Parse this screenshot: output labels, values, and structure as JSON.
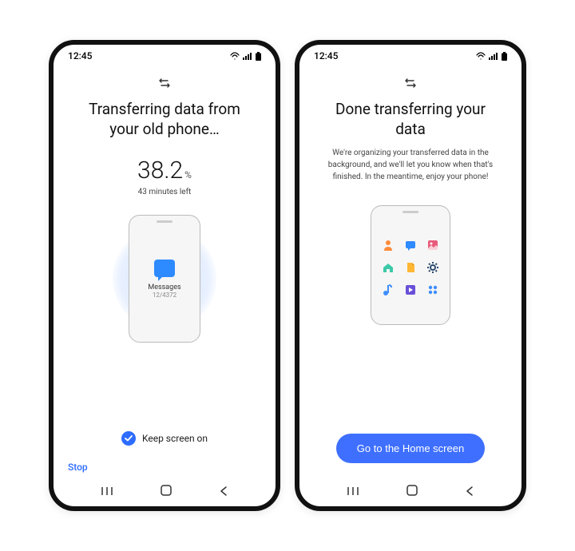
{
  "left": {
    "status": {
      "time": "12:45"
    },
    "title": "Transferring data from your old phone…",
    "percent_value": "38.2",
    "percent_symbol": "%",
    "time_left": "43 minutes left",
    "transfer_item": {
      "label": "Messages",
      "count": "12/4372",
      "icon": "message-icon"
    },
    "keep_screen_label": "Keep screen on",
    "stop_label": "Stop"
  },
  "right": {
    "status": {
      "time": "12:45"
    },
    "title": "Done transferring your data",
    "subtitle": "We're organizing your transferred data in the background, and we'll let you know when that's finished. In the meantime, enjoy your phone!",
    "grid_icons": [
      "contact-icon",
      "message-icon",
      "gallery-icon",
      "home-icon",
      "file-icon",
      "settings-icon",
      "music-icon",
      "video-icon",
      "apps-icon"
    ],
    "cta_label": "Go to the Home screen"
  },
  "colors": {
    "accent": "#3e6fff",
    "link": "#2d6cff"
  }
}
